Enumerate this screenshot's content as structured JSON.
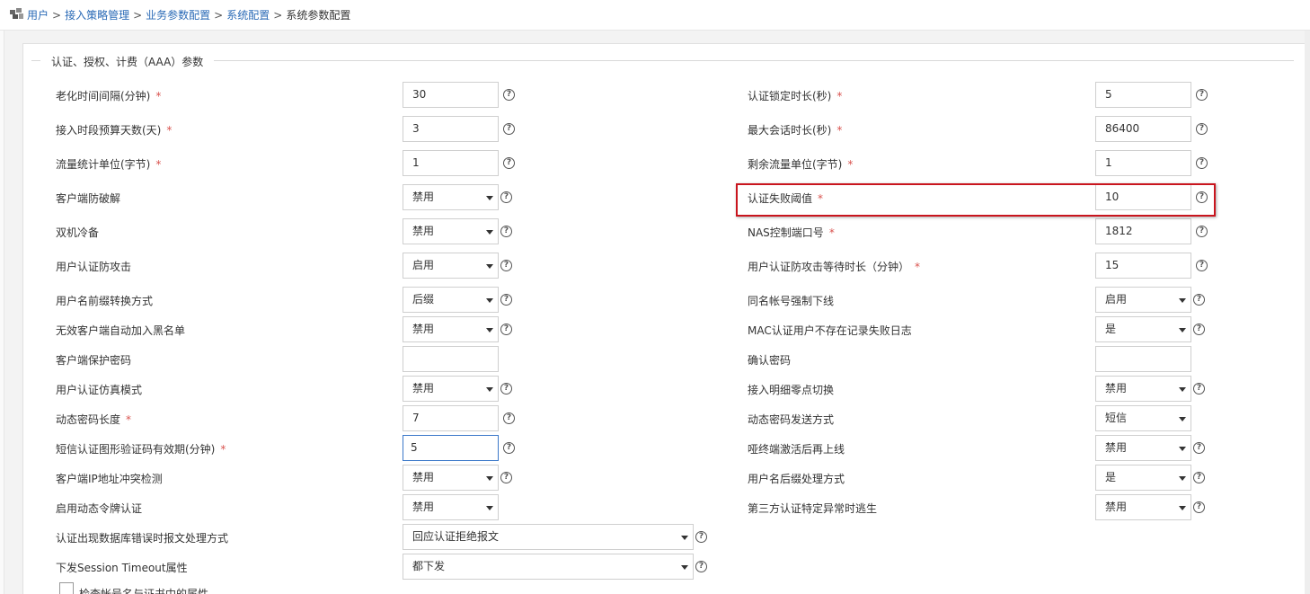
{
  "breadcrumb": {
    "items": [
      "用户",
      "接入策略管理",
      "业务参数配置",
      "系统配置"
    ],
    "separator": ">",
    "current": "系统参数配置"
  },
  "section": {
    "title": "认证、授权、计费（AAA）参数"
  },
  "required_mark": "*",
  "help_glyph": "?",
  "colors": {
    "link": "#2a6ab6",
    "required": "#d9534f",
    "highlight": "#c9151e",
    "focus": "#3b78c9"
  },
  "left": [
    {
      "label": "老化时间间隔(分钟)",
      "required": true,
      "type": "input",
      "value": "30",
      "help": true
    },
    {
      "label": "接入时段预算天数(天)",
      "required": true,
      "type": "input",
      "value": "3",
      "help": true
    },
    {
      "label": "流量统计单位(字节)",
      "required": true,
      "type": "input",
      "value": "1",
      "help": true
    },
    {
      "label": "客户端防破解",
      "required": false,
      "type": "select",
      "value": "禁用",
      "help": true
    },
    {
      "label": "双机冷备",
      "required": false,
      "type": "select",
      "value": "禁用",
      "help": true
    },
    {
      "label": "用户认证防攻击",
      "required": false,
      "type": "select",
      "value": "启用",
      "help": true
    },
    {
      "label": "用户名前缀转换方式",
      "required": false,
      "type": "select",
      "value": "后缀",
      "help": true
    },
    {
      "label": "无效客户端自动加入黑名单",
      "required": false,
      "type": "select",
      "value": "禁用",
      "help": true
    },
    {
      "label": "客户端保护密码",
      "required": false,
      "type": "input",
      "value": "",
      "help": false
    },
    {
      "label": "用户认证仿真模式",
      "required": false,
      "type": "select",
      "value": "禁用",
      "help": true
    },
    {
      "label": "动态密码长度",
      "required": true,
      "type": "input",
      "value": "7",
      "help": true
    },
    {
      "label": "短信认证图形验证码有效期(分钟)",
      "required": true,
      "type": "input",
      "value": "5",
      "help": true,
      "focused": true
    },
    {
      "label": "客户端IP地址冲突检测",
      "required": false,
      "type": "select",
      "value": "禁用",
      "help": true
    },
    {
      "label": "启用动态令牌认证",
      "required": false,
      "type": "select",
      "value": "禁用",
      "help": false
    },
    {
      "label": "认证出现数据库错误时报文处理方式",
      "required": false,
      "type": "select-wide",
      "value": "回应认证拒绝报文",
      "help": true
    },
    {
      "label": "下发Session Timeout属性",
      "required": false,
      "type": "select-wide",
      "value": "都下发",
      "help": true
    }
  ],
  "right": [
    {
      "label": "认证锁定时长(秒)",
      "required": true,
      "type": "input",
      "value": "5",
      "help": true
    },
    {
      "label": "最大会话时长(秒)",
      "required": true,
      "type": "input",
      "value": "86400",
      "help": true
    },
    {
      "label": "剩余流量单位(字节)",
      "required": true,
      "type": "input",
      "value": "1",
      "help": true
    },
    {
      "label": "认证失败阈值",
      "required": true,
      "type": "input",
      "value": "10",
      "help": true,
      "highlighted": true
    },
    {
      "label": "NAS控制端口号",
      "required": true,
      "type": "input",
      "value": "1812",
      "help": true
    },
    {
      "label": "用户认证防攻击等待时长（分钟）",
      "required": true,
      "type": "input",
      "value": "15",
      "help": true
    },
    {
      "label": "同名帐号强制下线",
      "required": false,
      "type": "select",
      "value": "启用",
      "help": true
    },
    {
      "label": "MAC认证用户不存在记录失败日志",
      "required": false,
      "type": "select",
      "value": "是",
      "help": true
    },
    {
      "label": "确认密码",
      "required": false,
      "type": "input",
      "value": "",
      "help": false
    },
    {
      "label": "接入明细零点切换",
      "required": false,
      "type": "select",
      "value": "禁用",
      "help": true
    },
    {
      "label": "动态密码发送方式",
      "required": false,
      "type": "select",
      "value": "短信",
      "help": false
    },
    {
      "label": "哑终端激活后再上线",
      "required": false,
      "type": "select",
      "value": "禁用",
      "help": true
    },
    {
      "label": "用户名后缀处理方式",
      "required": false,
      "type": "select",
      "value": "是",
      "help": true
    },
    {
      "label": "第三方认证特定异常时逃生",
      "required": false,
      "type": "select",
      "value": "禁用",
      "help": true
    }
  ],
  "checkbox": {
    "label": "检查帐号名与证书中的属性",
    "checked": false
  }
}
